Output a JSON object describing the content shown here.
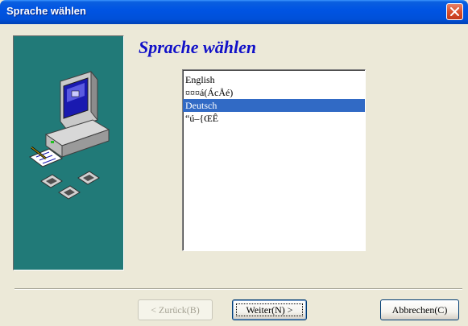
{
  "window": {
    "title": "Sprache wählen"
  },
  "heading": "Sprache wählen",
  "languages": [
    {
      "label": "English",
      "selected": false
    },
    {
      "label": "¤¤¤á(ÁcÅé)",
      "selected": false
    },
    {
      "label": "Deutsch",
      "selected": true
    },
    {
      "label": "“ú–{ŒÊ",
      "selected": false
    }
  ],
  "buttons": {
    "back": "< Zurück(B)",
    "next": "Weiter(N) >",
    "cancel": "Abbrechen(C)"
  },
  "colors": {
    "panel": "#217a78",
    "heading": "#1010c8",
    "selection": "#316ac5"
  }
}
